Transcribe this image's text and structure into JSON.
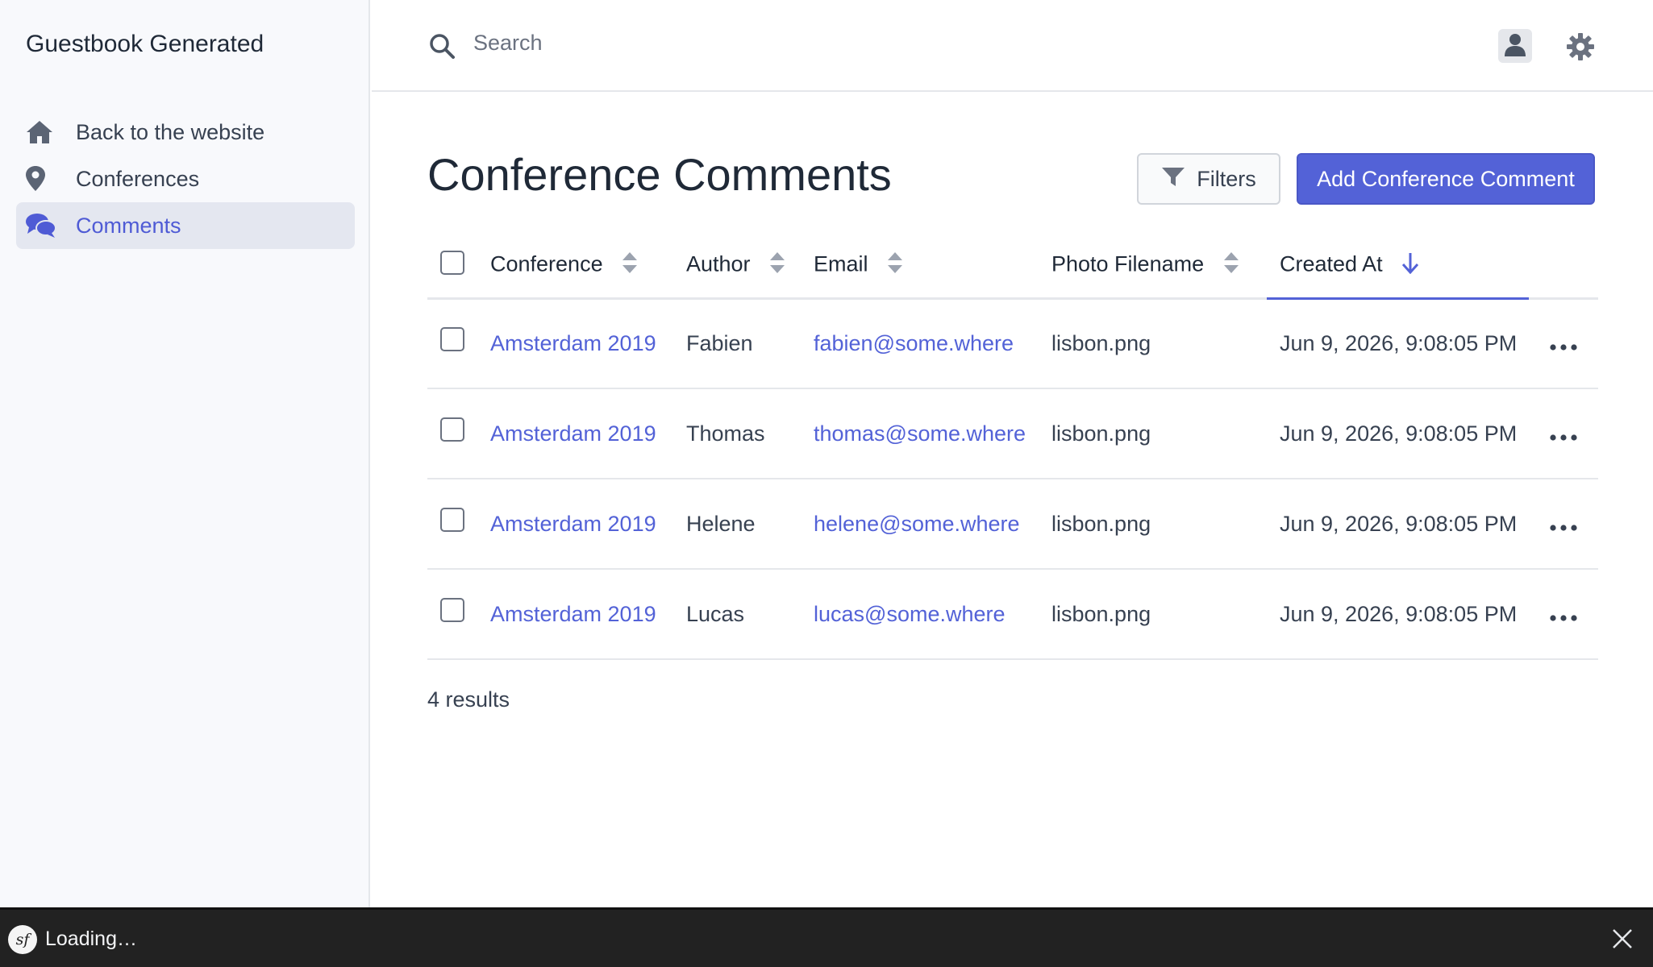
{
  "sidebar": {
    "brand": "Guestbook Generated",
    "items": [
      {
        "label": "Back to the website",
        "icon": "home-icon",
        "active": false
      },
      {
        "label": "Conferences",
        "icon": "map-marker-icon",
        "active": false
      },
      {
        "label": "Comments",
        "icon": "comments-icon",
        "active": true
      }
    ]
  },
  "header": {
    "search_placeholder": "Search",
    "user_icon": "user-icon",
    "settings_icon": "gear-icon"
  },
  "main": {
    "title": "Conference Comments",
    "filters_label": "Filters",
    "add_label": "Add Conference Comment",
    "columns": {
      "conference": "Conference",
      "author": "Author",
      "email": "Email",
      "photo": "Photo Filename",
      "created": "Created At"
    },
    "sorted_column": "Created At",
    "sort_direction": "desc",
    "rows": [
      {
        "conference": "Amsterdam 2019",
        "author": "Fabien",
        "email": "fabien@some.where",
        "photo": "lisbon.png",
        "created": "Jun 9, 2026, 9:08:05 PM"
      },
      {
        "conference": "Amsterdam 2019",
        "author": "Thomas",
        "email": "thomas@some.where",
        "photo": "lisbon.png",
        "created": "Jun 9, 2026, 9:08:05 PM"
      },
      {
        "conference": "Amsterdam 2019",
        "author": "Helene",
        "email": "helene@some.where",
        "photo": "lisbon.png",
        "created": "Jun 9, 2026, 9:08:05 PM"
      },
      {
        "conference": "Amsterdam 2019",
        "author": "Lucas",
        "email": "lucas@some.where",
        "photo": "lisbon.png",
        "created": "Jun 9, 2026, 9:08:05 PM"
      }
    ],
    "results": "4 results"
  },
  "debugbar": {
    "logo": "sf",
    "status": "Loading…"
  },
  "colors": {
    "accent": "#5362d7",
    "sidebar_bg": "#f8f9fc",
    "active_item_bg": "#e4e7f0",
    "debugbar_bg": "#222222"
  }
}
